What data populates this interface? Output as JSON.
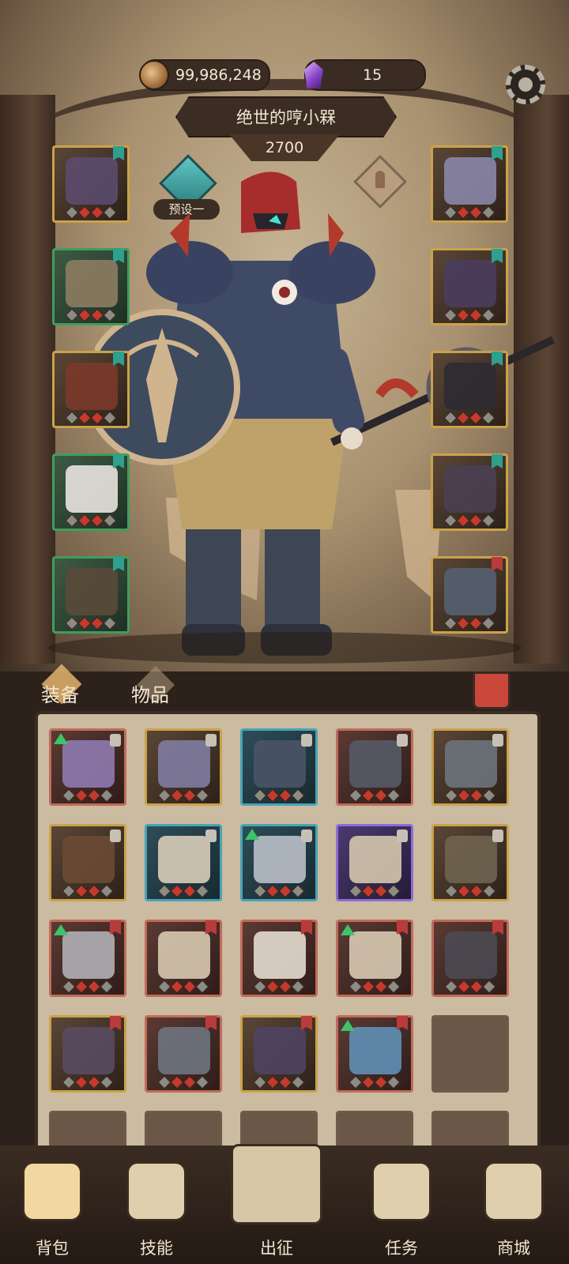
{
  "currency": {
    "gold": "99,986,248",
    "gems": "15"
  },
  "player": {
    "name": "绝世的哼小槑",
    "power": "2700",
    "preset_label": "预设一"
  },
  "equip_slots_left": [
    {
      "rarity": "gold",
      "art": "#5b4b6e"
    },
    {
      "rarity": "green",
      "art": "#8c7c62"
    },
    {
      "rarity": "gold",
      "art": "#7a3a2a"
    },
    {
      "rarity": "green",
      "art": "#e8e4de"
    },
    {
      "rarity": "green",
      "art": "#5a4a3a"
    }
  ],
  "equip_slots_right": [
    {
      "rarity": "gold",
      "art": "#8a86a8"
    },
    {
      "rarity": "gold",
      "art": "#4a3d5e"
    },
    {
      "rarity": "gold",
      "art": "#2e2b33"
    },
    {
      "rarity": "gold",
      "art": "#4b3f52"
    },
    {
      "rarity": "gold",
      "art": "#556070"
    }
  ],
  "tabs": {
    "equip": "装备",
    "items": "物品"
  },
  "inventory": [
    {
      "rarity": "red",
      "art": "#8f7ab0",
      "up": true,
      "lock": true
    },
    {
      "rarity": "gold",
      "art": "#7f7ca0",
      "up": false,
      "lock": true
    },
    {
      "rarity": "blue",
      "art": "#4a5466",
      "up": false,
      "lock": true
    },
    {
      "rarity": "red",
      "art": "#555a66",
      "up": false,
      "lock": true
    },
    {
      "rarity": "gold",
      "art": "#6d737c",
      "up": false,
      "lock": true
    },
    {
      "rarity": "gold",
      "art": "#6a4a35",
      "up": false,
      "lock": true
    },
    {
      "rarity": "blue",
      "art": "#d9cdb8",
      "up": false,
      "lock": true
    },
    {
      "rarity": "blue",
      "art": "#b9bfc8",
      "up": true,
      "lock": true
    },
    {
      "rarity": "purple",
      "art": "#d4c6ad",
      "up": false,
      "lock": true
    },
    {
      "rarity": "gold",
      "art": "#6f6450",
      "up": false,
      "lock": true
    },
    {
      "rarity": "red",
      "art": "#b0b0b5",
      "up": true,
      "lock": false
    },
    {
      "rarity": "red",
      "art": "#d7c9b0",
      "up": false,
      "lock": false
    },
    {
      "rarity": "red",
      "art": "#e4dccf",
      "up": false,
      "lock": false
    },
    {
      "rarity": "red",
      "art": "#d8cab2",
      "up": true,
      "lock": false
    },
    {
      "rarity": "red",
      "art": "#4b4a52",
      "up": false,
      "lock": false
    },
    {
      "rarity": "gold",
      "art": "#5a4a62",
      "up": false,
      "lock": false
    },
    {
      "rarity": "red",
      "art": "#6e7480",
      "up": false,
      "lock": false
    },
    {
      "rarity": "gold",
      "art": "#4f4262",
      "up": false,
      "lock": false
    },
    {
      "rarity": "red",
      "art": "#5f8fb5",
      "up": true,
      "lock": false
    },
    {
      "rarity": "empty",
      "art": "",
      "up": false,
      "lock": false
    },
    {
      "rarity": "empty",
      "art": "",
      "up": false,
      "lock": false
    },
    {
      "rarity": "empty",
      "art": "",
      "up": false,
      "lock": false
    },
    {
      "rarity": "empty",
      "art": "",
      "up": false,
      "lock": false
    },
    {
      "rarity": "empty",
      "art": "",
      "up": false,
      "lock": false
    },
    {
      "rarity": "empty",
      "art": "",
      "up": false,
      "lock": false
    }
  ],
  "nav": [
    {
      "label": "背包",
      "icon": "backpack-icon",
      "active": true
    },
    {
      "label": "技能",
      "icon": "skill-scroll-icon",
      "active": false
    },
    {
      "label": "出征",
      "icon": "campaign-sword-icon",
      "active": false
    },
    {
      "label": "任务",
      "icon": "quest-horn-icon",
      "active": false
    },
    {
      "label": "商城",
      "icon": "shop-crown-icon",
      "active": false
    }
  ],
  "colors": {
    "gold_border": "#cba24a",
    "green_border": "#3f9e5c",
    "red_border": "#c06b5a",
    "blue_border": "#4aa3b5",
    "purple_border": "#8e6bd8",
    "accent_teal": "#5ec5c2"
  }
}
